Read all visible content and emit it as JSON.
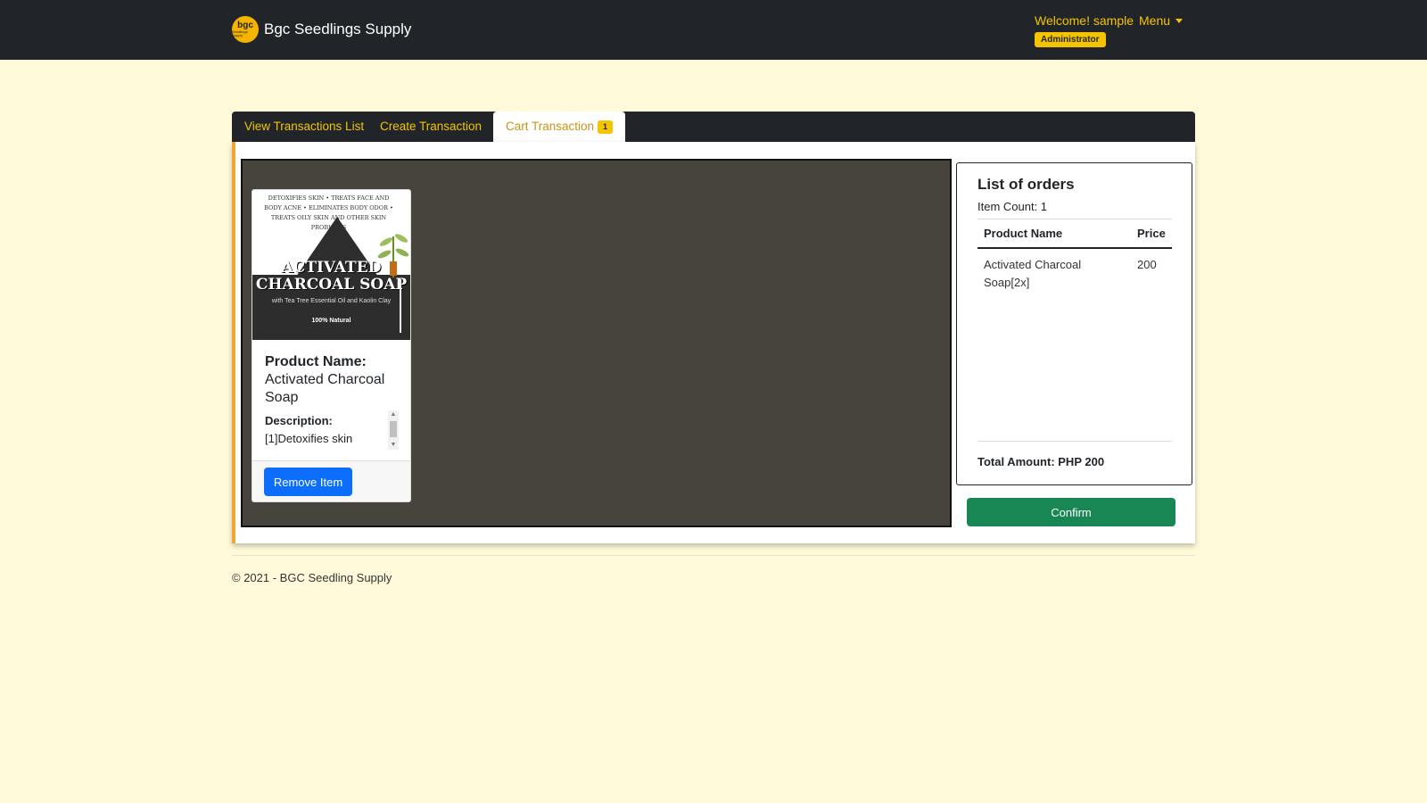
{
  "header": {
    "brand_logo_text": "bgc",
    "brand_logo_subtext": "Seedlings Supply",
    "brand_name": "Bgc Seedlings Supply",
    "welcome": "Welcome! sample",
    "menu_label": "Menu",
    "role_badge": "Administrator"
  },
  "tabs": [
    {
      "label": "View Transactions List",
      "active": false
    },
    {
      "label": "Create Transaction",
      "active": false
    },
    {
      "label": "Cart Transaction",
      "active": true,
      "badge": "1"
    }
  ],
  "cart": {
    "items": [
      {
        "image": {
          "top_text": "DETOXIFIES SKIN • TREATS FACE AND BODY ACNE • ELIMINATES BODY ODOR • TREATS OILY SKIN AND OTHER SKIN PROBLEMS",
          "title_line1": "ACTIVATED",
          "title_line2": "CHARCOAL SOAP",
          "subtitle": "with Tea Tree Essential Oil and Kaolin Clay",
          "natural": "100% Natural"
        },
        "name_label": "Product Name:",
        "name": "Activated Charcoal Soap",
        "description_label": "Description:",
        "description": "[1]Detoxifies skin",
        "remove_label": "Remove Item"
      }
    ]
  },
  "orders": {
    "title": "List of orders",
    "item_count": "Item Count: 1",
    "columns": [
      "Product Name",
      "Price"
    ],
    "rows": [
      {
        "product": "Activated Charcoal Soap[2x]",
        "price": "200"
      }
    ],
    "total": "Total Amount: PHP 200",
    "confirm_label": "Confirm"
  },
  "footer": {
    "copyright": "© 2021 - BGC Seedling Supply"
  },
  "colors": {
    "page_bg": "#fffbda",
    "navbar_bg": "#212529",
    "accent_yellow": "#f5c400",
    "primary_button": "#0d6efd",
    "confirm_button": "#198754",
    "cart_area_bg": "#46443c",
    "card_left_border": "#f2a533"
  }
}
